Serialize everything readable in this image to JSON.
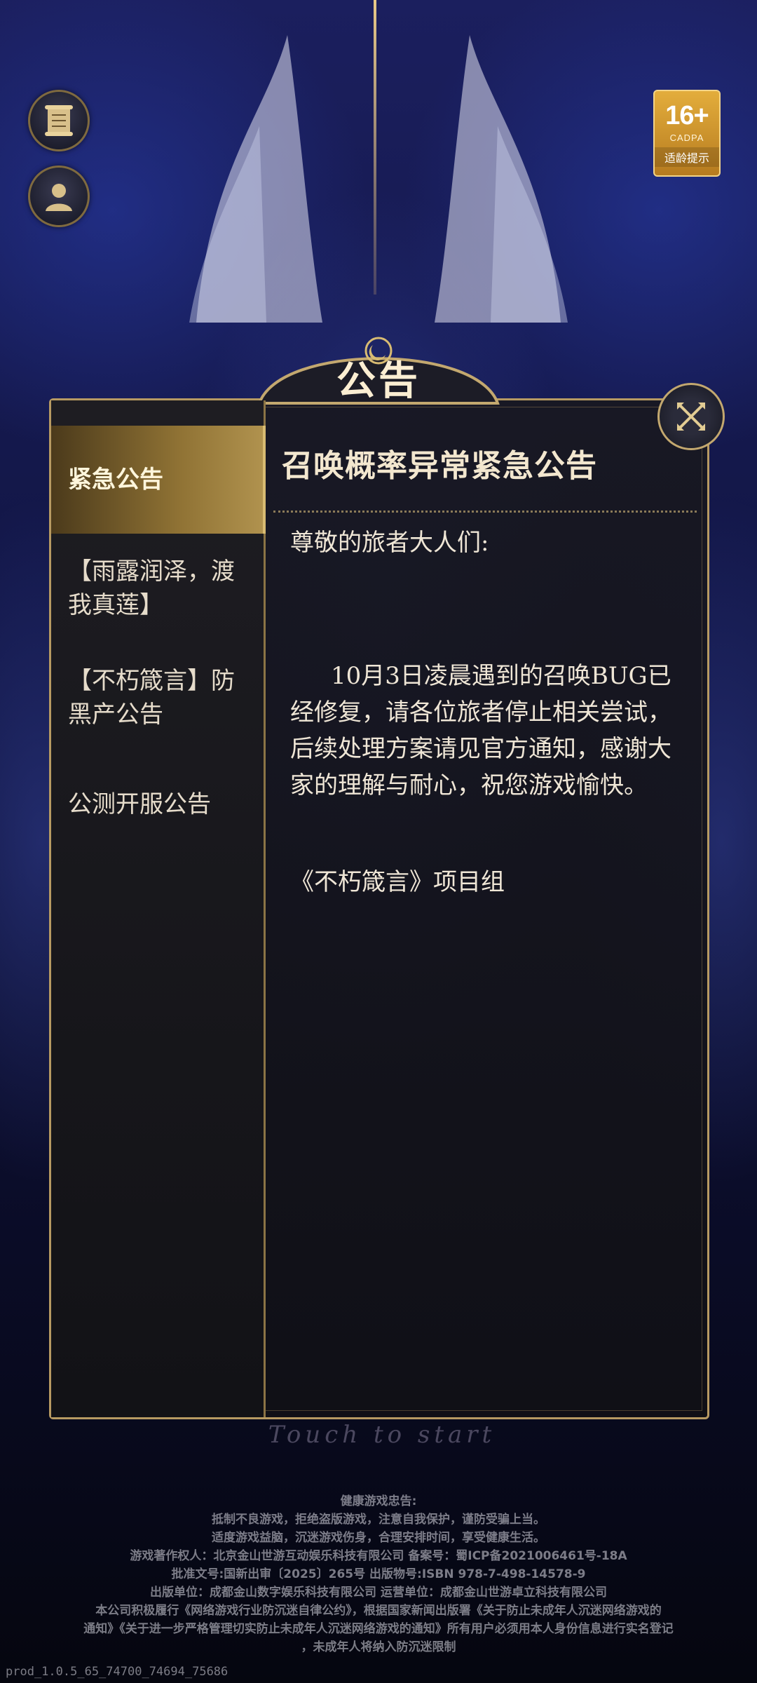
{
  "age_rating": {
    "number": "16+",
    "org": "CADPA",
    "tip": "适龄提示"
  },
  "panel": {
    "title": "公告"
  },
  "sidebar": {
    "items": [
      {
        "label": "紧急公告"
      },
      {
        "label": "【雨露润泽，渡我真莲】"
      },
      {
        "label": "【不朽箴言】防黑产公告"
      },
      {
        "label": "公测开服公告"
      }
    ]
  },
  "content": {
    "title": "召唤概率异常紧急公告",
    "greeting": "尊敬的旅者大人们:",
    "body": "10月3日凌晨遇到的召唤BUG已经修复，请各位旅者停止相关尝试，后续处理方案请见官方通知，感谢大家的理解与耐心，祝您游戏愉快。",
    "signature": "《不朽箴言》项目组"
  },
  "touch_to_start": "Touch to start",
  "footer": {
    "lines": [
      "健康游戏忠告:",
      "抵制不良游戏，拒绝盗版游戏，注意自我保护，谨防受骗上当。",
      "适度游戏益脑，沉迷游戏伤身，合理安排时间，享受健康生活。",
      "游戏著作权人：北京金山世游互动娱乐科技有限公司    备案号：蜀ICP备2021006461号-18A",
      "批准文号:国新出审〔2025〕265号    出版物号:ISBN 978-7-498-14578-9",
      "出版单位：成都金山数字娱乐科技有限公司    运营单位：成都金山世游卓立科技有限公司",
      "本公司积极履行《网络游戏行业防沉迷自律公约》，根据国家新闻出版署《关于防止未成年人沉迷网络游戏的",
      "通知》《关于进一步严格管理切实防止未成年人沉迷网络游戏的通知》所有用户必须用本人身份信息进行实名登记",
      "，未成年人将纳入防沉迷限制"
    ]
  },
  "build": "prod_1.0.5_65_74700_74694_75686",
  "colors": {
    "gold": "#b79a62",
    "active_tab": "#8f7234",
    "badge": "#d99a2b"
  }
}
